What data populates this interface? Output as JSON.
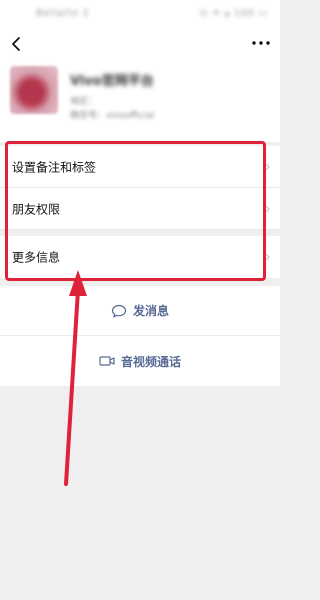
{
  "status_bar": {
    "left_text": "Bellarte 2",
    "right_text": "⊙ ✕ ▴ 100 ▭"
  },
  "profile": {
    "name": "Vivo官网平台",
    "line1": "地区：",
    "line2": "微信号：vivoofficial"
  },
  "settings": {
    "items": [
      {
        "label": "设置备注和标签"
      },
      {
        "label": "朋友权限"
      },
      {
        "label": "更多信息"
      }
    ]
  },
  "actions": {
    "message_label": "发消息",
    "call_label": "音视频通话"
  },
  "colors": {
    "annotation_red": "#e0213a",
    "link_blue": "#576b95"
  },
  "icons": [
    "back-arrow-icon",
    "more-dots-icon",
    "chat-bubble-icon",
    "video-camera-icon",
    "chevron-right-icon"
  ]
}
